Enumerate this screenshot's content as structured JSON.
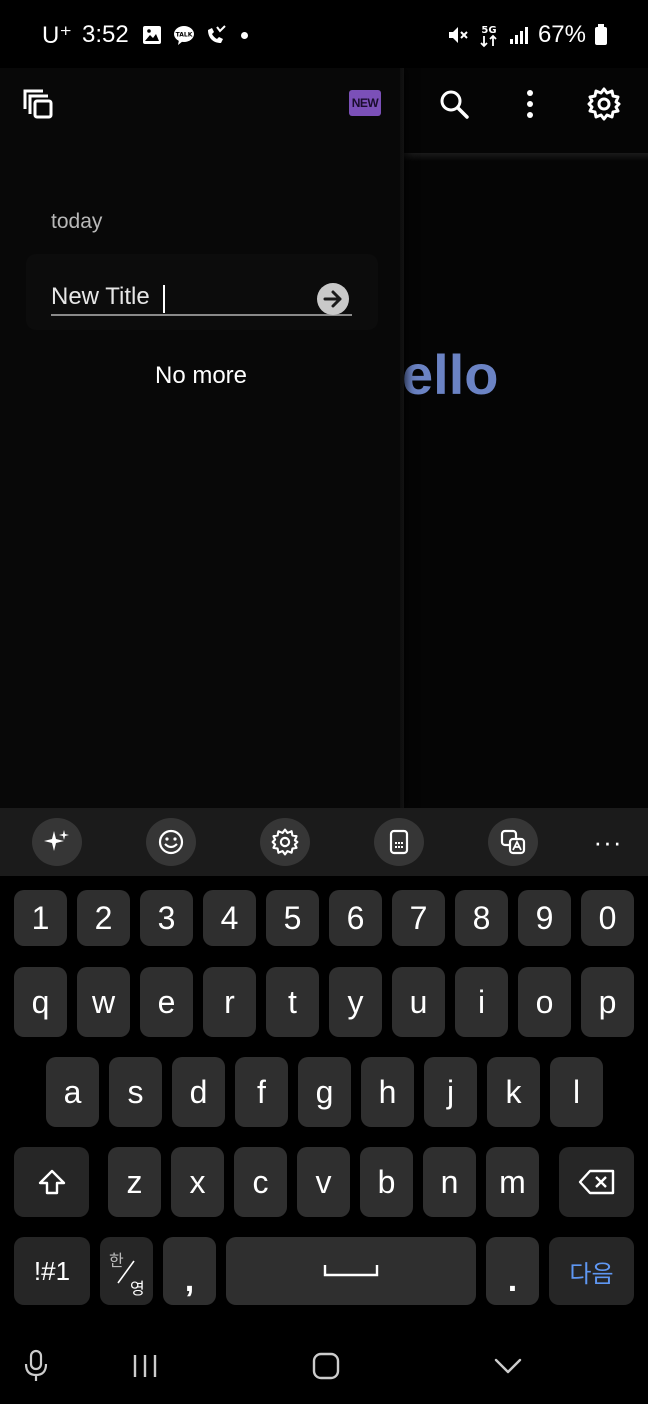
{
  "status_bar": {
    "carrier": "U⁺",
    "time": "3:52",
    "battery": "67%",
    "network": "5G"
  },
  "toolbar": {
    "new_badge": "NEW"
  },
  "main": {
    "hello_text": "ello"
  },
  "drawer": {
    "section_label": "today",
    "title_input_value": "New Title",
    "no_more_text": "No more"
  },
  "keyboard": {
    "number_row": [
      "1",
      "2",
      "3",
      "4",
      "5",
      "6",
      "7",
      "8",
      "9",
      "0"
    ],
    "row1": [
      "q",
      "w",
      "e",
      "r",
      "t",
      "y",
      "u",
      "i",
      "o",
      "p"
    ],
    "row2": [
      "a",
      "s",
      "d",
      "f",
      "g",
      "h",
      "j",
      "k",
      "l"
    ],
    "row3": [
      "z",
      "x",
      "c",
      "v",
      "b",
      "n",
      "m"
    ],
    "symbols_key": "!#1",
    "lang_key_top": "한",
    "lang_key_bottom": "영",
    "comma_key": ",",
    "period_key": ".",
    "next_key": "다음",
    "more_tools": "···"
  },
  "colors": {
    "accent_purple": "#7b50b8",
    "hello_blue": "#6b83c4",
    "next_blue": "#5f97f2"
  },
  "icons": {
    "toolbar": [
      "copy-icon",
      "search-icon",
      "more-vert-icon",
      "settings-icon"
    ],
    "kb_tools": [
      "ai-sparkle-icon",
      "emoji-icon",
      "settings-icon",
      "keyboard-layout-icon",
      "translate-icon"
    ],
    "nav": [
      "mic-icon",
      "recents-icon",
      "home-icon",
      "hide-keyboard-icon"
    ]
  }
}
